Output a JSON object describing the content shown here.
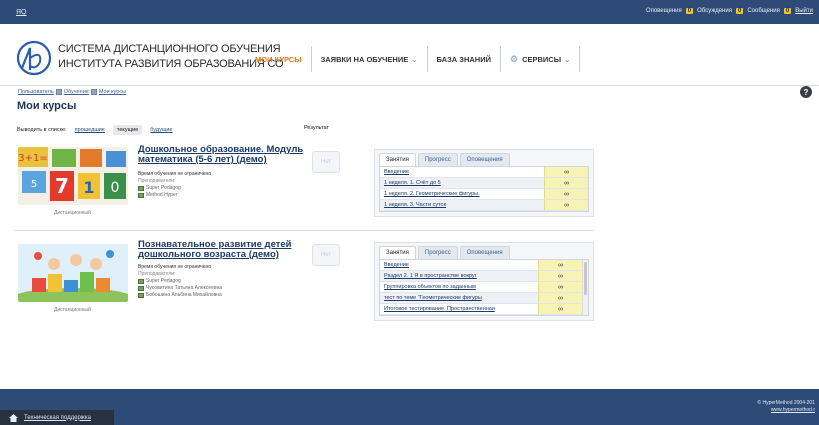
{
  "topbar": {
    "user": "ЯQ",
    "notifications_label": "Оповещения",
    "notifications_count": "0",
    "discussions_label": "Обсуждения",
    "discussions_count": "0",
    "messages_label": "Сообщения",
    "messages_count": "0",
    "logout": "Выйти"
  },
  "header": {
    "logo_line1": "СИСТЕМА ДИСТАНЦИОННОГО ОБУЧЕНИЯ",
    "logo_line2": "ИНСТИТУТА РАЗВИТИЯ ОБРАЗОВАНИЯ СО",
    "nav": [
      {
        "label": "МОИ КУРСЫ"
      },
      {
        "label": "ЗАЯВКИ НА ОБУЧЕНИЕ"
      },
      {
        "label": "БАЗА ЗНАНИЙ"
      },
      {
        "label": "СЕРВИСЫ"
      }
    ]
  },
  "breadcrumb": [
    "Пользователь",
    "Обучение",
    "Мои курсы"
  ],
  "page_title": "Мои курсы",
  "filter": {
    "label": "Выводить в списке:",
    "options": [
      "прошедшие",
      "текущие",
      "будущие"
    ]
  },
  "result_header": "Результат",
  "courses": [
    {
      "title": "Дошкольное образование. Модуль математика (5-6 лет) (демо)",
      "time": "Время обучения не ограничено",
      "teachers_label": "Преподаватели:",
      "teachers": [
        "Super Pedagog",
        "Method Hyper"
      ],
      "caption": "Дистанционный",
      "result": "Нет",
      "tabs": [
        "Занятия",
        "Прогресс",
        "Оповещения"
      ],
      "lessons": [
        {
          "name": "Введение",
          "value": "∞"
        },
        {
          "name": "1 неделя. 1. Счёт до 5",
          "value": "∞"
        },
        {
          "name": "1 неделя. 2. Геометрические фигуры.",
          "value": "∞"
        },
        {
          "name": "1 неделя. 3. Части суток",
          "value": "∞"
        }
      ]
    },
    {
      "title": "Познавательное развитие детей дошкольного возраста (демо)",
      "time": "Время обучения не ограничено",
      "teachers_label": "Преподаватели:",
      "teachers": [
        "Super Pedagog",
        "Чусовитина Татьяна Алексеевна",
        "Бобошина Альбина Михайловна"
      ],
      "caption": "Дистанционный",
      "result": "Нет",
      "tabs": [
        "Занятия",
        "Прогресс",
        "Оповещения"
      ],
      "lessons": [
        {
          "name": "Введение",
          "value": "∞"
        },
        {
          "name": "Раздел 2. 1 Я в пространстве вокруг",
          "value": "∞"
        },
        {
          "name": "Группировка объектов по заданным",
          "value": "∞"
        },
        {
          "name": "тест по теме \"Геометрические фигуры",
          "value": "∞"
        },
        {
          "name": "Итоговое тестирование. Пространственная",
          "value": "∞"
        }
      ]
    }
  ],
  "footer": {
    "copyright": "© HyperMethod 2004-201",
    "link": "www.hypermethod.r"
  },
  "support": "Техническая поддержка",
  "colors": {
    "topbar": "#2e4b77",
    "accent": "#d9791c",
    "badge": "#f2c230",
    "lesson_value_bg": "#f6f3b5"
  }
}
